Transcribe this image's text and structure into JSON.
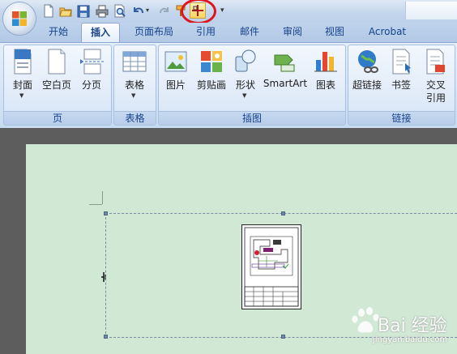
{
  "colors": {
    "accent": "#15428b",
    "highlight": "#e0141e",
    "page": "#d1e8d4"
  },
  "quick_access": {
    "icons": [
      "new-doc-icon",
      "open-folder-icon",
      "save-icon",
      "print-icon",
      "print-preview-icon",
      "undo-icon",
      "redo-icon",
      "format-painter-icon",
      "custom-command-icon"
    ],
    "more": "▾"
  },
  "tabs": [
    "开始",
    "插入",
    "页面布局",
    "引用",
    "邮件",
    "审阅",
    "视图",
    "Acrobat"
  ],
  "active_tab": "插入",
  "groups": {
    "pages": {
      "label": "页",
      "buttons": [
        "封面",
        "空白页",
        "分页"
      ]
    },
    "tables": {
      "label": "表格",
      "buttons": [
        "表格"
      ]
    },
    "illustrations": {
      "label": "插图",
      "buttons": [
        "图片",
        "剪贴画",
        "形状",
        "SmartArt",
        "图表"
      ]
    },
    "links": {
      "label": "链接",
      "buttons": [
        "超链接",
        "书签",
        "交叉",
        "引用"
      ]
    }
  },
  "watermark": {
    "brand": "Bai 经验",
    "url": "jingyan.baidu.com"
  }
}
